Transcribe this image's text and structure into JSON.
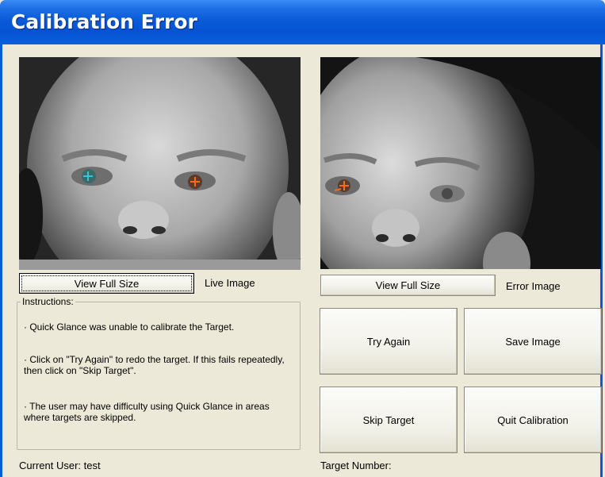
{
  "window": {
    "title": "Calibration Error"
  },
  "live_panel": {
    "view_button": "View Full Size",
    "caption": "Live Image"
  },
  "error_panel": {
    "view_button": "View Full Size",
    "caption": "Error Image"
  },
  "instructions": {
    "legend": "Instructions:",
    "lines": [
      "· Quick Glance was unable to calibrate the Target.",
      "· Click on \"Try Again\" to redo the target.  If this fails repeatedly, then click on \"Skip Target\".",
      "· The user may have difficulty using Quick Glance in areas where targets are skipped."
    ]
  },
  "actions": {
    "try_again": "Try Again",
    "save_image": "Save Image",
    "skip_target": "Skip Target",
    "quit_calibration": "Quit Calibration"
  },
  "status": {
    "current_user": "Current User: test",
    "target_number": "Target Number:"
  },
  "colors": {
    "title_bar": "#0a5bd8",
    "window_bg": "#ece9d8",
    "marker_cyan": "#39c2d6",
    "marker_orange": "#ff6a14"
  }
}
